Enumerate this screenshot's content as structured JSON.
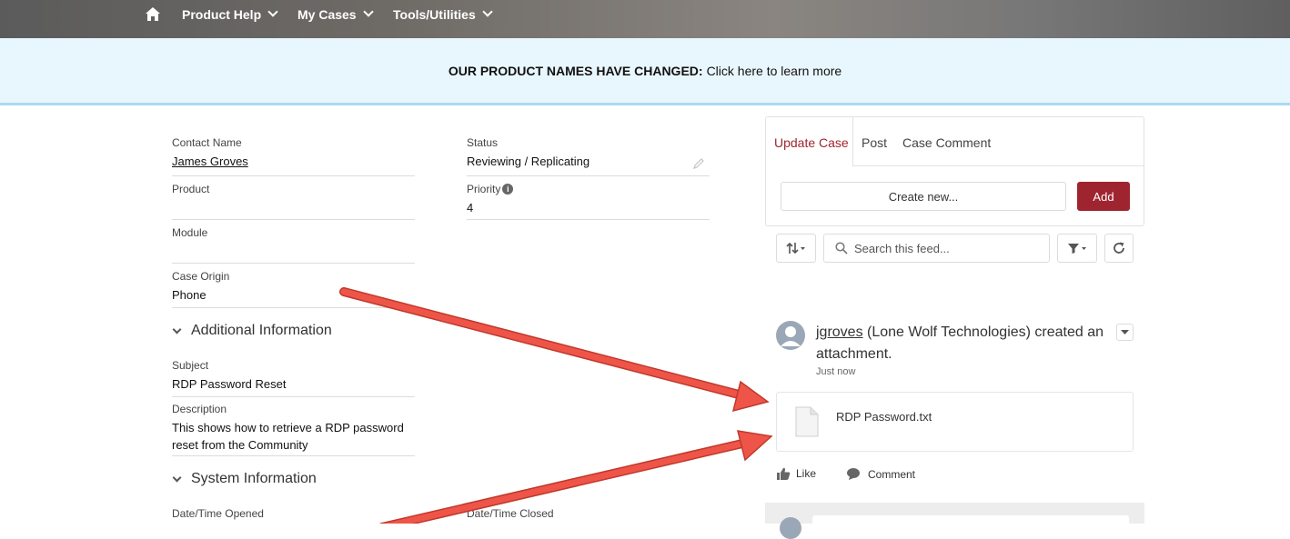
{
  "nav": {
    "items": [
      {
        "label": "Product Help"
      },
      {
        "label": "My Cases"
      },
      {
        "label": "Tools/Utilities"
      }
    ]
  },
  "banner": {
    "bold": "OUR PRODUCT NAMES HAVE CHANGED:",
    "text": "Click here to learn more"
  },
  "details": {
    "contact_name_label": "Contact Name",
    "contact_name": "James Groves",
    "status_label": "Status",
    "status": "Reviewing / Replicating",
    "product_label": "Product",
    "priority_label": "Priority",
    "priority": "4",
    "module_label": "Module",
    "case_origin_label": "Case Origin",
    "case_origin": "Phone"
  },
  "additional": {
    "title": "Additional Information",
    "subject_label": "Subject",
    "subject": "RDP Password Reset",
    "description_label": "Description",
    "description_line1": "This shows how to retrieve a RDP password",
    "description_line2": "reset from the Community"
  },
  "system": {
    "title": "System Information",
    "opened_label": "Date/Time Opened",
    "closed_label": "Date/Time Closed"
  },
  "publisher": {
    "tabs": [
      "Update Case",
      "Post",
      "Case Comment"
    ],
    "create_placeholder": "Create new...",
    "add_label": "Add"
  },
  "feed": {
    "search_placeholder": "Search this feed...",
    "user": "jgroves",
    "action_text": " (Lone Wolf Technologies) created an attachment.",
    "time": "Just now",
    "attachment_name": "RDP Password.txt",
    "like_label": "Like",
    "comment_label": "Comment"
  },
  "colors": {
    "brand": "#9e2530",
    "banner_bg": "#e8f6fd",
    "arrow": "#e8493f"
  },
  "icons": [
    "home-icon",
    "chevron-down-icon",
    "pencil-icon",
    "info-icon",
    "sort-icon",
    "search-icon",
    "filter-icon",
    "refresh-icon",
    "avatar-icon",
    "file-icon",
    "like-icon",
    "comment-icon"
  ]
}
